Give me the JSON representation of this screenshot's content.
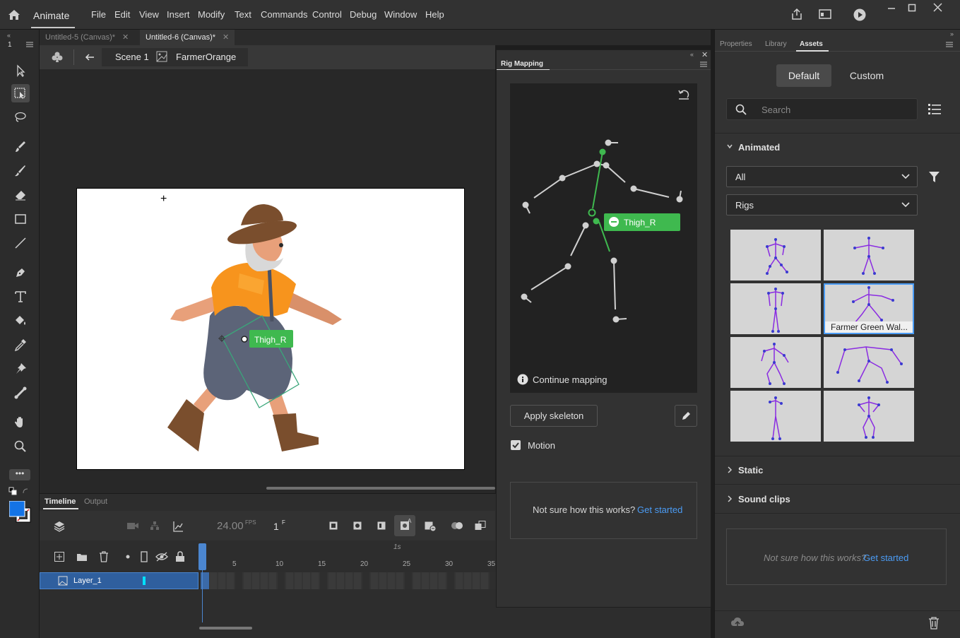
{
  "app": {
    "name": "Animate",
    "menu": [
      "File",
      "Edit",
      "View",
      "Insert",
      "Modify",
      "Text",
      "Commands",
      "Control",
      "Debug",
      "Window",
      "Help"
    ]
  },
  "documents": {
    "tabs": [
      {
        "label": "Untitled-5 (Canvas)*",
        "active": false
      },
      {
        "label": "Untitled-6 (Canvas)*",
        "active": true
      }
    ]
  },
  "editbar": {
    "scene": "Scene 1",
    "symbol": "FarmerOrange"
  },
  "stage": {
    "bone_label": "Thigh_R"
  },
  "timeline": {
    "tabs": [
      "Timeline",
      "Output"
    ],
    "fps": "24.00",
    "fps_unit": "FPS",
    "frame": "1",
    "frame_unit": "F",
    "ruler_second": "1s",
    "ruler_marks": [
      "5",
      "10",
      "15",
      "20",
      "25",
      "30",
      "35"
    ],
    "layer_name": "Layer_1"
  },
  "rig_mapping": {
    "title": "Rig Mapping",
    "selected_bone": "Thigh_R",
    "continue_text": "Continue mapping",
    "apply_button": "Apply skeleton",
    "motion_label": "Motion",
    "motion_checked": true,
    "help_text": "Not sure how this works?",
    "help_link": "Get started"
  },
  "right_panel": {
    "tabs": [
      "Properties",
      "Library",
      "Assets"
    ],
    "active_tab": "Assets",
    "mode_buttons": [
      "Default",
      "Custom"
    ],
    "search_placeholder": "Search",
    "animated_label": "Animated",
    "filter_all": "All",
    "filter_rigs": "Rigs",
    "selected_thumb_caption": "Farmer Green Wal...",
    "static_label": "Static",
    "sound_label": "Sound clips",
    "help_text": "Not sure how this works?",
    "help_link": "Get started"
  },
  "colors": {
    "accent_blue": "#4b9cf5",
    "bone_green": "#3fb94f",
    "fill_color": "#1473e6",
    "rig_purple": "#8a2be2"
  }
}
